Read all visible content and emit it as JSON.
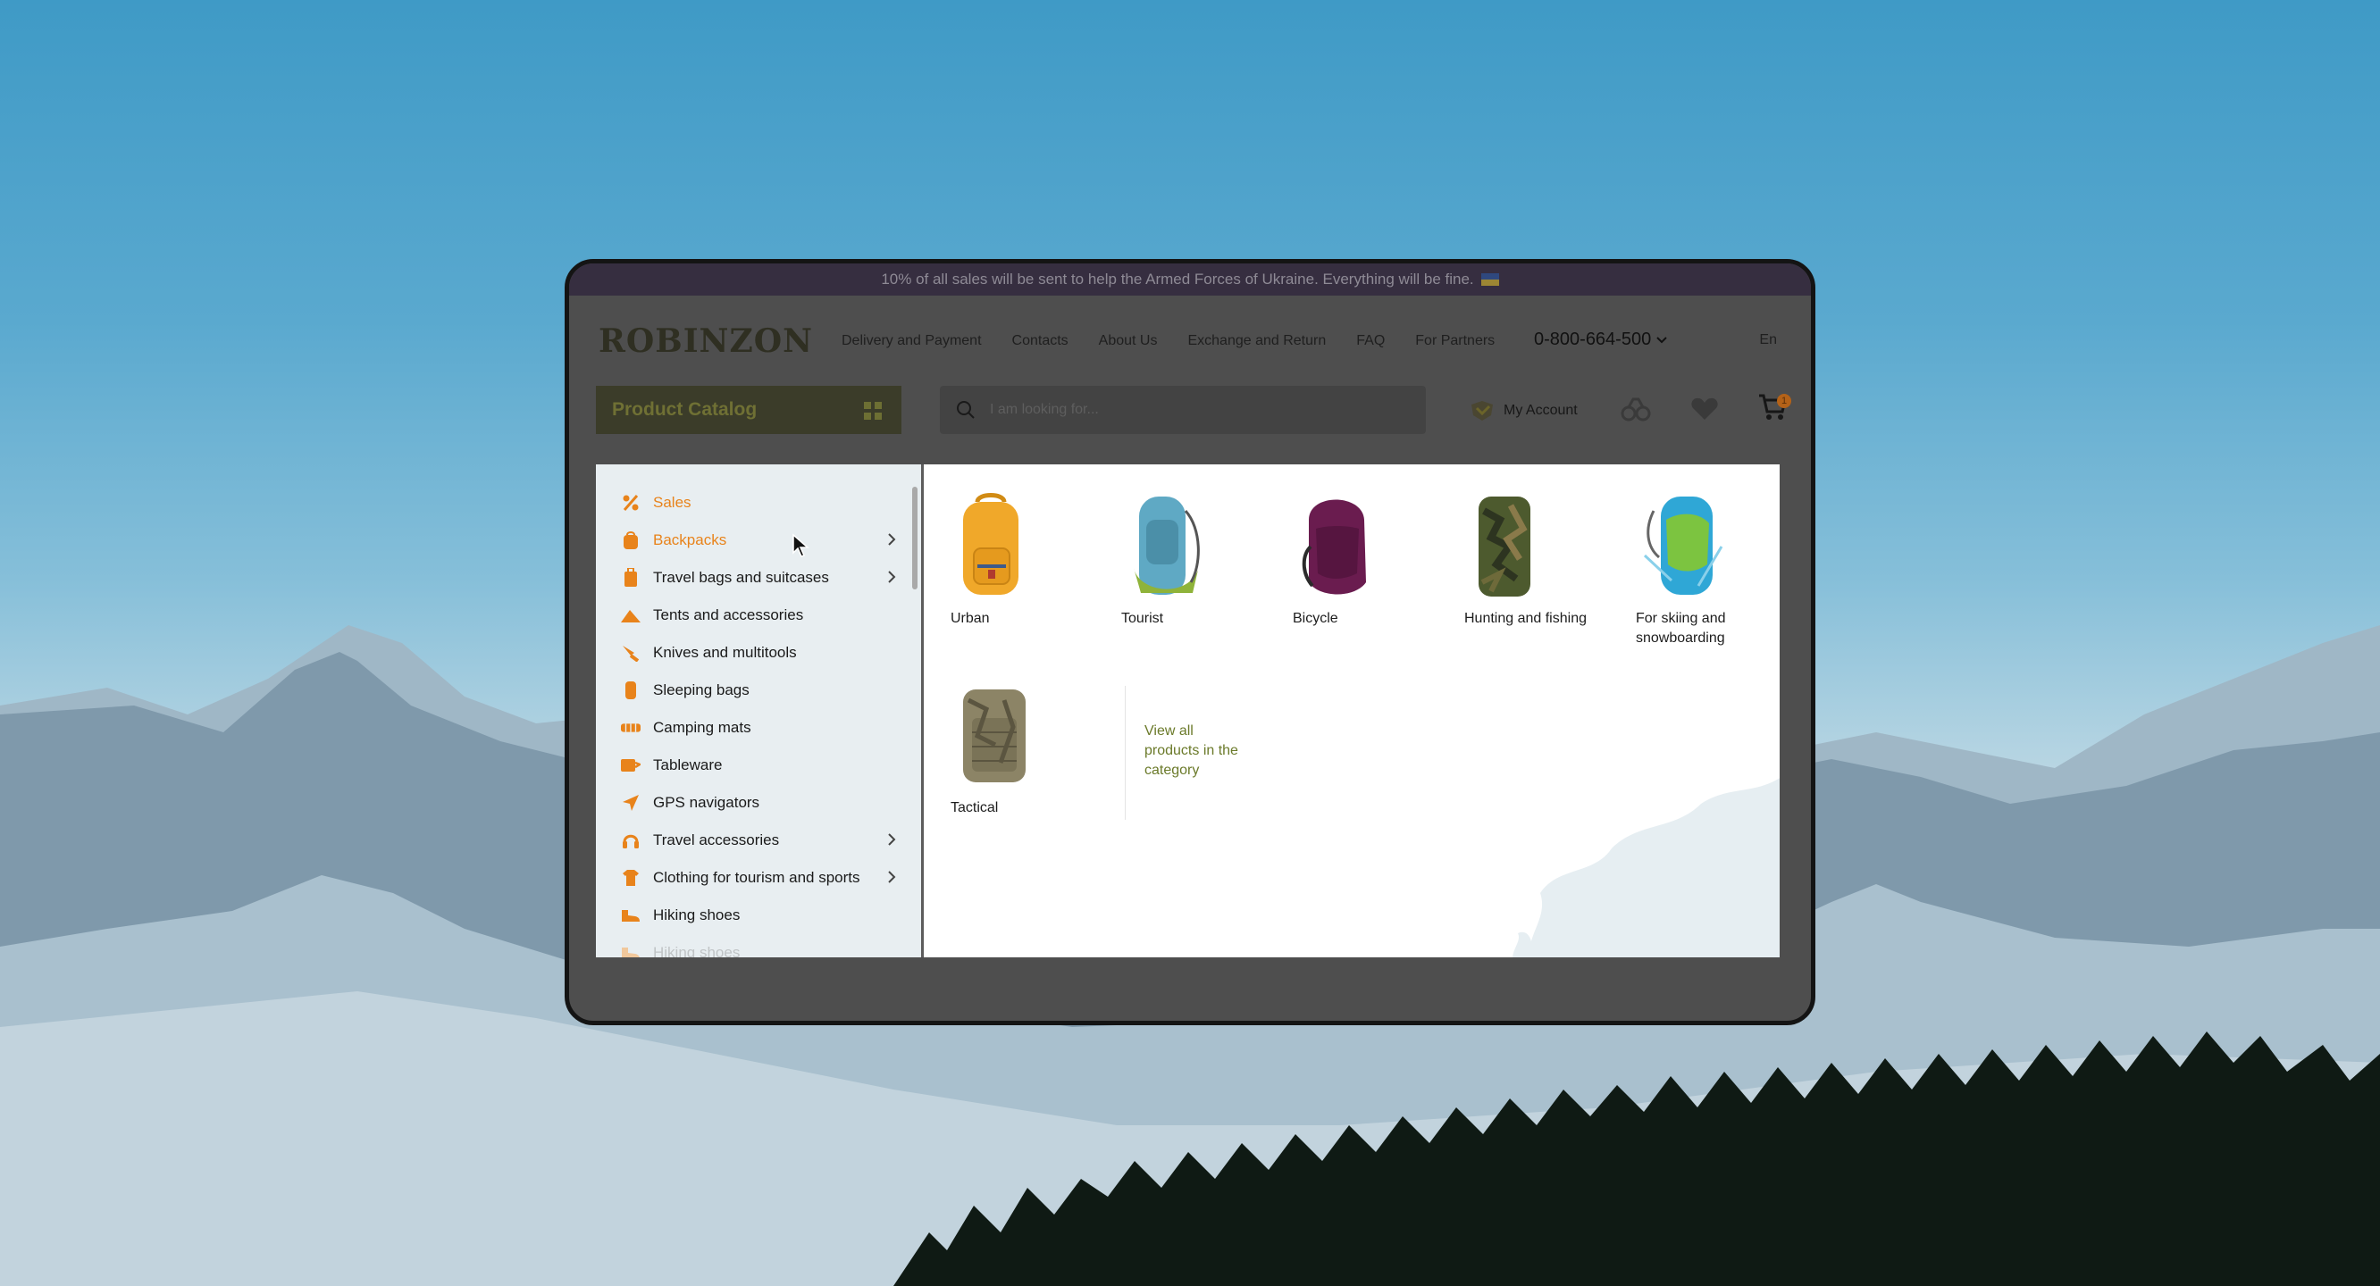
{
  "banner": {
    "text": "10% of all sales will be sent to help the Armed Forces of Ukraine. Everything will be fine."
  },
  "header": {
    "logo": "ROBINZON",
    "nav": [
      "Delivery and Payment",
      "Contacts",
      "About Us",
      "Exchange and Return",
      "FAQ",
      "For Partners"
    ],
    "phone": "0-800-664-500",
    "language": "En"
  },
  "toolbar": {
    "catalog_label": "Product Catalog",
    "search_placeholder": "I am looking for...",
    "account_label": "My Account",
    "cart_count": "1"
  },
  "menu": {
    "items": [
      {
        "label": "Sales",
        "icon": "percent-icon",
        "highlight": true,
        "submenu": false
      },
      {
        "label": "Backpacks",
        "icon": "backpack-icon",
        "highlight": true,
        "submenu": true
      },
      {
        "label": "Travel bags and suitcases",
        "icon": "suitcase-icon",
        "highlight": false,
        "submenu": true
      },
      {
        "label": "Tents and accessories",
        "icon": "tent-icon",
        "highlight": false,
        "submenu": false
      },
      {
        "label": "Knives and multitools",
        "icon": "knife-icon",
        "highlight": false,
        "submenu": false
      },
      {
        "label": "Sleeping bags",
        "icon": "sleeping-bag-icon",
        "highlight": false,
        "submenu": false
      },
      {
        "label": "Camping mats",
        "icon": "mat-icon",
        "highlight": false,
        "submenu": false
      },
      {
        "label": "Tableware",
        "icon": "tableware-icon",
        "highlight": false,
        "submenu": false
      },
      {
        "label": "GPS navigators",
        "icon": "gps-icon",
        "highlight": false,
        "submenu": false
      },
      {
        "label": "Travel accessories",
        "icon": "headphones-icon",
        "highlight": false,
        "submenu": true
      },
      {
        "label": "Clothing for tourism and sports",
        "icon": "tshirt-icon",
        "highlight": false,
        "submenu": true
      },
      {
        "label": "Hiking shoes",
        "icon": "shoe-icon",
        "highlight": false,
        "submenu": false
      },
      {
        "label": "Hiking shoes",
        "icon": "shoe-icon",
        "highlight": false,
        "submenu": false
      }
    ]
  },
  "subcategories": {
    "items": [
      {
        "label": "Urban",
        "color": "#f0a82a"
      },
      {
        "label": "Tourist",
        "color": "#5fa9c4"
      },
      {
        "label": "Bicycle",
        "color": "#6a1c4f"
      },
      {
        "label": "Hunting and fishing",
        "color": "#4d5a2e"
      },
      {
        "label": "For skiing and snowboarding",
        "color": "#2fa7d6"
      },
      {
        "label": "Tactical",
        "color": "#8c8466"
      }
    ],
    "view_all": "View all products in the category"
  },
  "colors": {
    "accent": "#e8831b",
    "olive": "#6b7a2a",
    "sidebar_bg": "#e8eef1"
  }
}
